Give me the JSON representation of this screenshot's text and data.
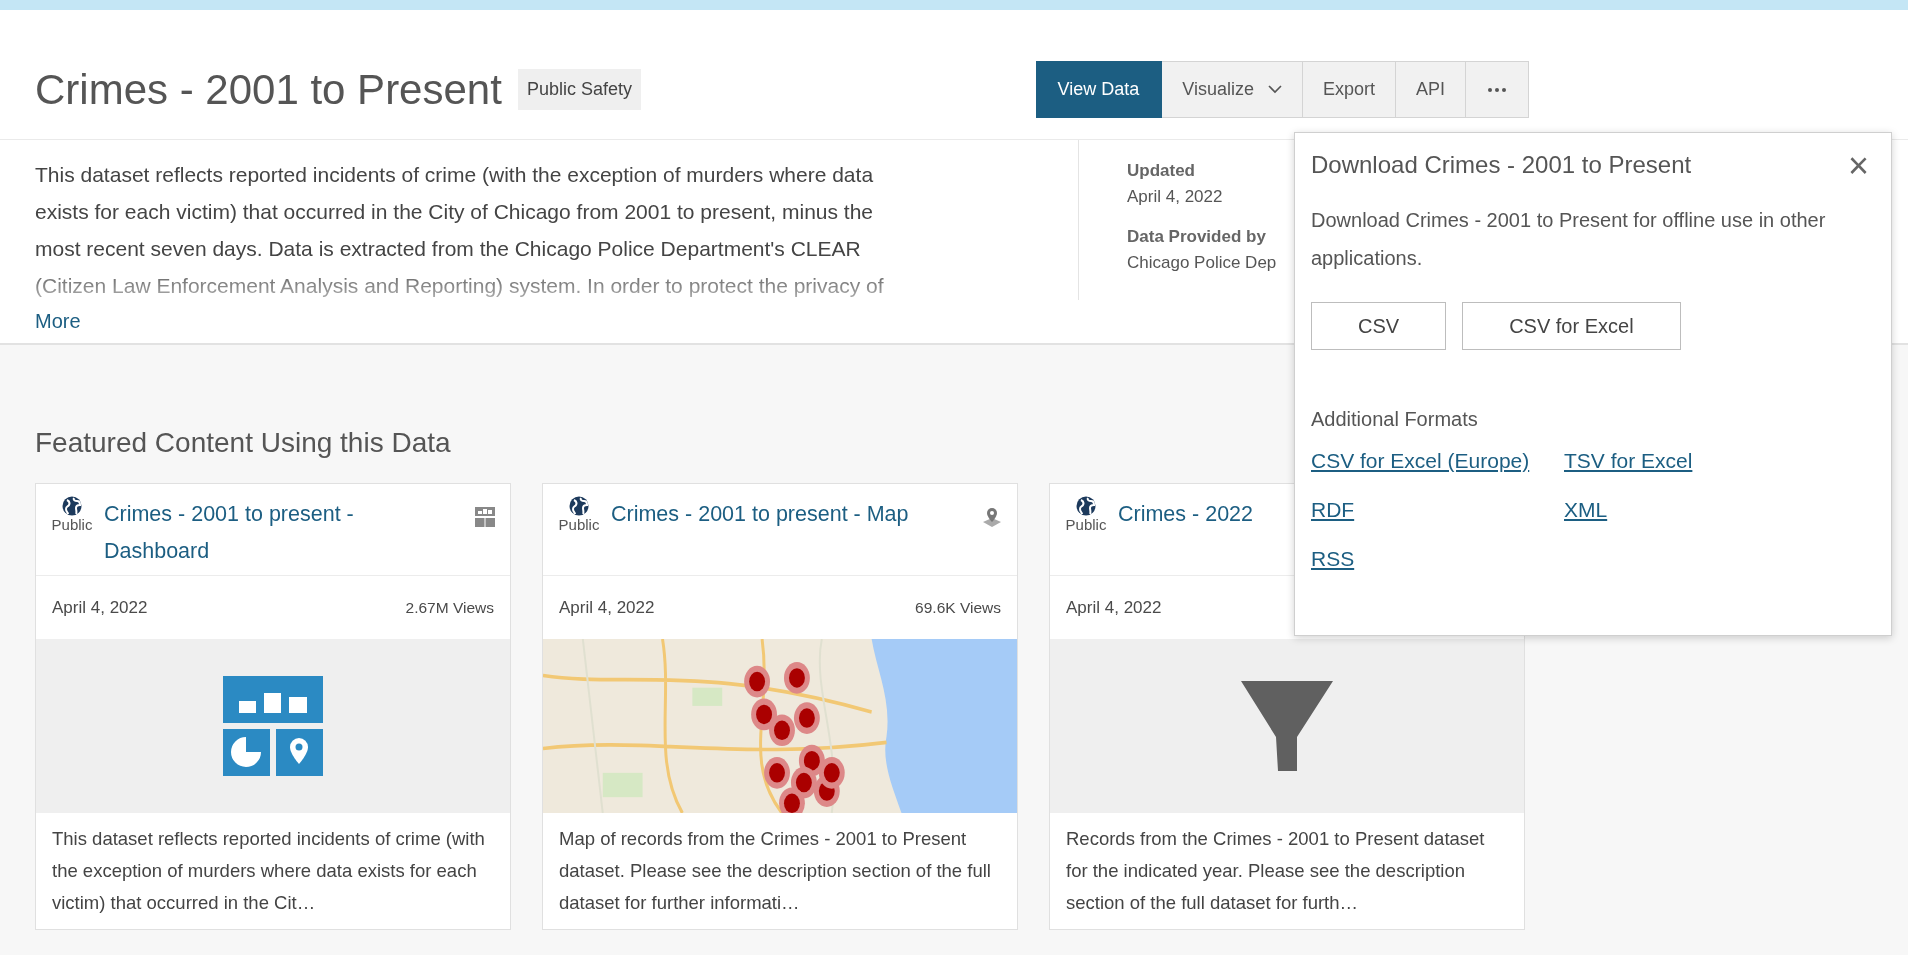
{
  "dataset": {
    "title": "Crimes - 2001 to Present",
    "category": "Public Safety"
  },
  "actions": [
    {
      "kind": "button",
      "label": "View Data",
      "selected": true
    },
    {
      "kind": "dropdown",
      "label": "Visualize",
      "selected": false
    },
    {
      "kind": "button",
      "label": "Export",
      "selected": false
    },
    {
      "kind": "button",
      "label": "API",
      "selected": false
    },
    {
      "kind": "more",
      "selected": false
    }
  ],
  "description": {
    "text": "This dataset reflects reported incidents of crime (with the exception of murders where data exists for each victim) that occurred in the City of Chicago from 2001 to present, minus the most recent seven days. Data is extracted from the Chicago Police Department's CLEAR (Citizen Law Enforcement Analysis and Reporting) system. In order to protect the privacy of",
    "more_link": "More"
  },
  "meta": [
    {
      "label": "Updated",
      "value": "April 4, 2022"
    },
    {
      "label": "Data Provided by",
      "value": "Chicago Police Dep"
    }
  ],
  "featured": {
    "heading": "Featured Content Using this Data",
    "cards": [
      {
        "visibility": "Public",
        "title": "Crimes - 2001 to present - Dashboard",
        "kind": "dashboard",
        "date": "April 4, 2022",
        "views": "2.67M Views",
        "description": "This dataset reflects reported incidents of crime (with the exception of murders where data exists for each victim) that occurred in the Cit…"
      },
      {
        "visibility": "Public",
        "title": "Crimes - 2001 to present - Map",
        "kind": "map",
        "date": "April 4, 2022",
        "views": "69.6K Views",
        "description": "Map of records from the Crimes - 2001 to Present dataset. Please see the description section of the full dataset for further informati…"
      },
      {
        "visibility": "Public",
        "title": "Crimes - 2022",
        "kind": "filter",
        "date": "April 4, 2022",
        "description": "Records from the Crimes - 2001 to Present dataset for the indicated year. Please see the description section of the full dataset for furth…"
      }
    ]
  },
  "download_dialog": {
    "title": "Download Crimes - 2001 to Present",
    "close": "×",
    "text": "Download Crimes - 2001 to Present for offline use in other applications.",
    "buttons": [
      "CSV",
      "CSV for Excel"
    ],
    "additional_heading": "Additional Formats",
    "formats": [
      "CSV for Excel (Europe)",
      "TSV for Excel",
      "RDF",
      "XML",
      "RSS"
    ]
  }
}
